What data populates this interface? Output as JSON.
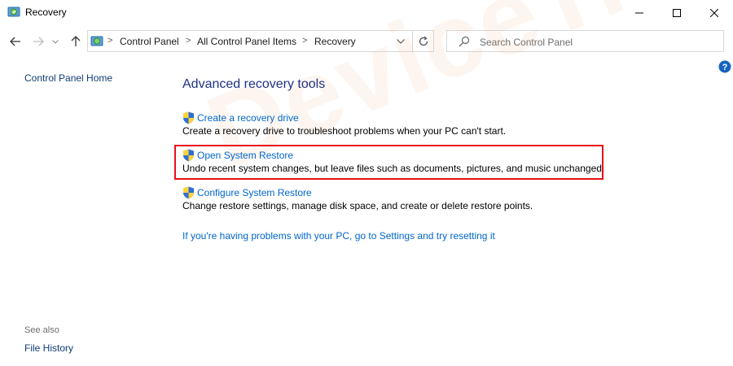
{
  "window": {
    "title": "Recovery",
    "app_icon": "recovery-icon",
    "controls": [
      "minimize-icon",
      "maximize-icon",
      "close-icon"
    ]
  },
  "nav": {
    "back_icon": "arrow-left-icon",
    "forward_icon": "arrow-right-icon",
    "recent_icon": "chevron-down-icon",
    "up_icon": "arrow-up-icon"
  },
  "address": {
    "crumbs": [
      "Control Panel",
      "All Control Panel Items",
      "Recovery"
    ],
    "separator": ">",
    "dropdown_icon": "chevron-down-icon",
    "refresh_icon": "refresh-icon"
  },
  "search": {
    "placeholder": "Search Control Panel",
    "value": ""
  },
  "help": {
    "label": "?",
    "icon": "help-icon"
  },
  "left_pane": {
    "home_link": "Control Panel Home",
    "see_also_label": "See also",
    "see_also_links": [
      "File History"
    ]
  },
  "main": {
    "heading": "Advanced recovery tools",
    "tasks": [
      {
        "link": "Create a recovery drive",
        "description": "Create a recovery drive to troubleshoot problems when your PC can't start.",
        "icon": "uac-shield-icon"
      },
      {
        "link": "Open System Restore",
        "description": "Undo recent system changes, but leave files such as documents, pictures, and music unchanged.",
        "icon": "uac-shield-icon",
        "highlighted": true
      },
      {
        "link": "Configure System Restore",
        "description": "Change restore settings, manage disk space, and create or delete restore points.",
        "icon": "uac-shield-icon"
      }
    ],
    "reset_link": "If you're having problems with your PC, go to Settings and try resetting it"
  },
  "watermark": {
    "text": "DeviceTricks"
  },
  "colors": {
    "link": "#0066cc",
    "heading": "#1e3287",
    "highlight_border": "#e8101a",
    "watermark": "#f3a36c"
  }
}
